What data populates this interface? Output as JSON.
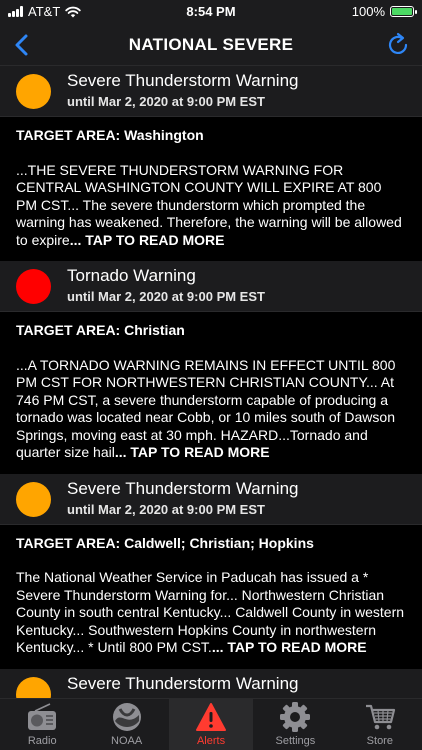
{
  "status_bar": {
    "carrier": "AT&T",
    "time": "8:54 PM",
    "battery_percent": "100%",
    "battery_fill": 1.0
  },
  "nav": {
    "title": "NATIONAL SEVERE",
    "back_icon": "chevron-left-icon",
    "refresh_icon": "refresh-icon",
    "accent_color": "#2e86f6"
  },
  "alerts": [
    {
      "title": "Severe Thunderstorm Warning",
      "expires": "until Mar 2, 2020 at 9:00 PM EST",
      "color": "#ffa500",
      "target_area": "TARGET AREA: Washington",
      "description": "...THE SEVERE THUNDERSTORM WARNING FOR CENTRAL WASHINGTON COUNTY WILL EXPIRE AT 800 PM CST... The severe thunderstorm which prompted the warning has weakened. Therefore, the warning will be allowed to expire",
      "read_more": "... TAP TO READ MORE"
    },
    {
      "title": "Tornado Warning",
      "expires": "until Mar 2, 2020 at 9:00 PM EST",
      "color": "#ff0000",
      "target_area": "TARGET AREA: Christian",
      "description": "...A TORNADO WARNING REMAINS IN EFFECT UNTIL 800 PM CST FOR NORTHWESTERN CHRISTIAN COUNTY... At 746 PM CST, a severe thunderstorm capable of producing a tornado was located near Cobb, or 10 miles south of Dawson Springs, moving east at 30 mph. HAZARD...Tornado and quarter size hail",
      "read_more": "... TAP TO READ MORE"
    },
    {
      "title": "Severe Thunderstorm Warning",
      "expires": "until Mar 2, 2020 at 9:00 PM EST",
      "color": "#ffa500",
      "target_area": "TARGET AREA: Caldwell; Christian; Hopkins",
      "description": "The National Weather Service in Paducah has issued a * Severe Thunderstorm Warning for... Northwestern Christian County in south central Kentucky... Caldwell County in western Kentucky... Southwestern Hopkins County in northwestern Kentucky... * Until 800 PM CST.",
      "read_more": "... TAP TO READ MORE"
    },
    {
      "title": "Severe Thunderstorm Warning",
      "expires": "",
      "color": "#ffa500",
      "target_area": "",
      "description": "",
      "read_more": ""
    }
  ],
  "tabs": [
    {
      "label": "Radio",
      "icon": "radio-icon",
      "active": false
    },
    {
      "label": "NOAA",
      "icon": "noaa-logo-icon",
      "active": false
    },
    {
      "label": "Alerts",
      "icon": "warning-icon",
      "active": true
    },
    {
      "label": "Settings",
      "icon": "gear-icon",
      "active": false
    },
    {
      "label": "Store",
      "icon": "shopping-cart-icon",
      "active": false
    }
  ],
  "colors": {
    "bar_background": "#1c1c1e",
    "active_tab": "#ff3b30",
    "inactive_tab": "#9e9ea3"
  }
}
